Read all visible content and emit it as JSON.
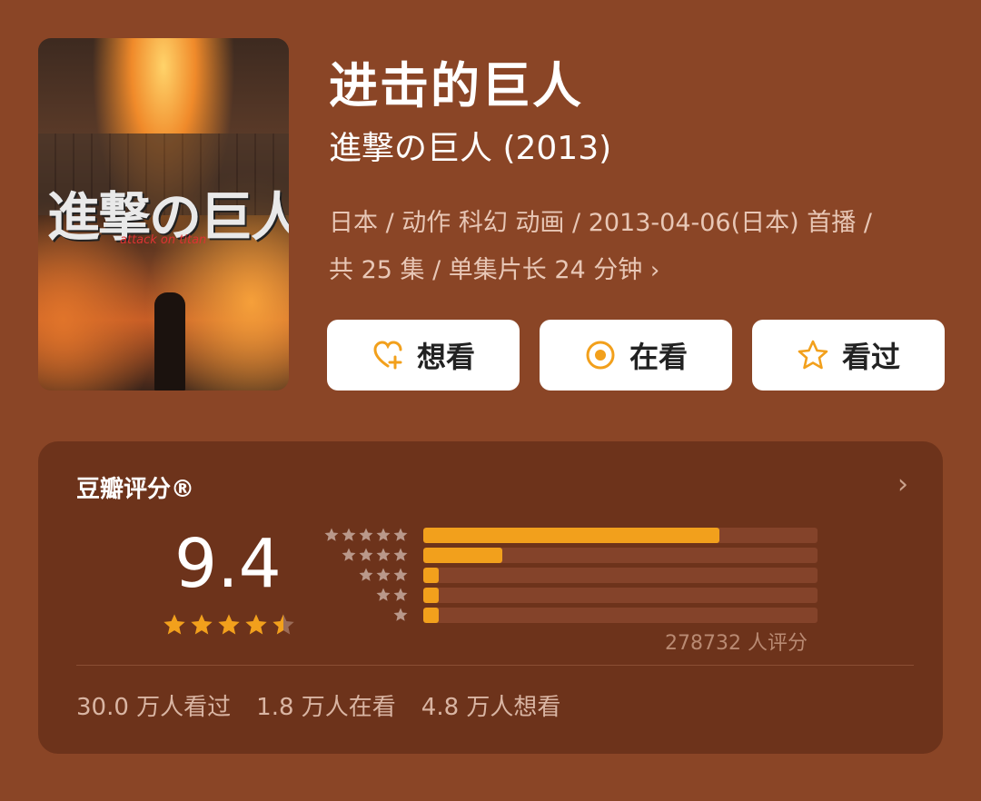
{
  "movie": {
    "title": "进击的巨人",
    "original_title": "進撃の巨人 (2013)",
    "meta_line1": "日本 / 动作 科幻 动画 / 2013-04-06(日本) 首播 /",
    "meta_line2": "共 25 集 / 单集片长 24 分钟",
    "poster_logo": "進撃の巨人",
    "poster_subtitle": "attack on titan"
  },
  "actions": {
    "want_label": "想看",
    "watching_label": "在看",
    "watched_label": "看过"
  },
  "rating": {
    "panel_title": "豆瓣评分®",
    "score": "9.4",
    "stars": 4.5,
    "distribution": [
      {
        "stars": 5,
        "percent": 75
      },
      {
        "stars": 4,
        "percent": 20
      },
      {
        "stars": 3,
        "percent": 4
      },
      {
        "stars": 2,
        "percent": 4
      },
      {
        "stars": 1,
        "percent": 4
      }
    ],
    "count_text": "278732 人评分",
    "watched_text": "30.0 万人看过",
    "watching_text": "1.8 万人在看",
    "want_text": "4.8 万人想看"
  },
  "colors": {
    "background": "#8a4526",
    "panel": "#6d331b",
    "accent": "#f2a01c",
    "track": "#84432a"
  },
  "icons": {
    "want": "heart-plus-icon",
    "watching": "target-icon",
    "watched": "star-outline-icon",
    "chevron": "chevron-right-icon"
  }
}
